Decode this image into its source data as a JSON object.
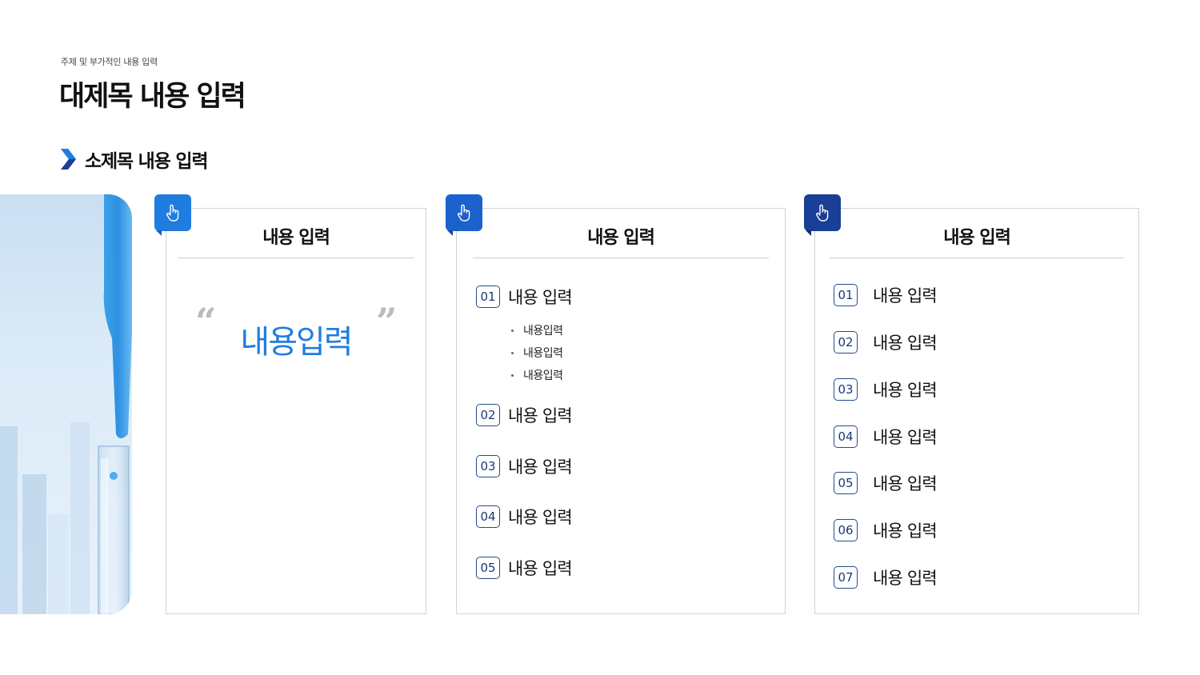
{
  "header": {
    "subtitle": "주제 및 부가적인 내용 입력",
    "title": "대제목 내용 입력"
  },
  "section": {
    "label": "소제목 내용 입력"
  },
  "colors": {
    "accent_1": "#1f7de0",
    "accent_2": "#1b62cc",
    "accent_3": "#1a3f96"
  },
  "card1": {
    "icon": "hand-pointer-icon",
    "title": "내용 입력",
    "quote_open": "“",
    "quote_close": "”",
    "highlight": "내용입력"
  },
  "card2": {
    "icon": "hand-pointer-icon",
    "title": "내용 입력",
    "items": [
      {
        "num": "01",
        "label": "내용 입력"
      },
      {
        "num": "02",
        "label": "내용 입력"
      },
      {
        "num": "03",
        "label": "내용 입력"
      },
      {
        "num": "04",
        "label": "내용 입력"
      },
      {
        "num": "05",
        "label": "내용 입력"
      }
    ],
    "sub_items": [
      "내용입력",
      "내용입력",
      "내용입력"
    ]
  },
  "card3": {
    "icon": "hand-pointer-icon",
    "title": "내용 입력",
    "items": [
      {
        "num": "01",
        "label": "내용 입력"
      },
      {
        "num": "02",
        "label": "내용 입력"
      },
      {
        "num": "03",
        "label": "내용 입력"
      },
      {
        "num": "04",
        "label": "내용 입력"
      },
      {
        "num": "05",
        "label": "내용 입력"
      },
      {
        "num": "06",
        "label": "내용 입력"
      },
      {
        "num": "07",
        "label": "내용 입력"
      }
    ]
  }
}
